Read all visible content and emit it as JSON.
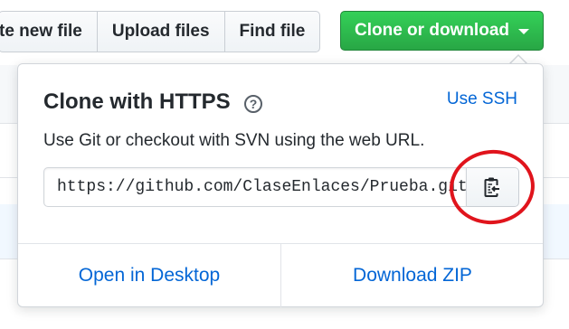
{
  "toolbar": {
    "create_new_file_label": "te new file",
    "upload_files_label": "Upload files",
    "find_file_label": "Find file",
    "clone_download_label": "Clone or download"
  },
  "clone_popup": {
    "title": "Clone with HTTPS",
    "help_icon": "question-circle-icon",
    "use_ssh_label": "Use SSH",
    "description": "Use Git or checkout with SVN using the web URL.",
    "url_value": "https://github.com/ClaseEnlaces/Prueba.git",
    "copy_icon": "clipboard-icon",
    "open_desktop_label": "Open in Desktop",
    "download_zip_label": "Download ZIP"
  },
  "colors": {
    "clone_button": "#28a745",
    "link": "#0366d6",
    "annotation_circle": "#e0141c"
  }
}
